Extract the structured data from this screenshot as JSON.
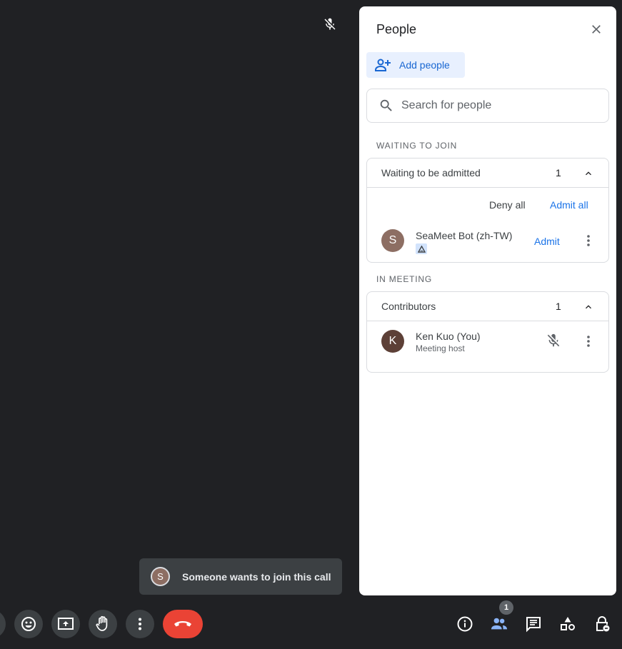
{
  "panel": {
    "title": "People",
    "add_people_label": "Add people",
    "search_placeholder": "Search for people",
    "waiting_section": {
      "label": "WAITING TO JOIN",
      "group_label": "Waiting to be admitted",
      "count": "1",
      "deny_all_label": "Deny all",
      "admit_all_label": "Admit all",
      "people": [
        {
          "initial": "S",
          "name": "SeaMeet Bot (zh-TW)",
          "avatar_color": "#8d6e63",
          "admit_label": "Admit"
        }
      ]
    },
    "meeting_section": {
      "label": "IN MEETING",
      "group_label": "Contributors",
      "count": "1",
      "people": [
        {
          "initial": "K",
          "name": "Ken Kuo (You)",
          "role": "Meeting host",
          "avatar_color": "#5d4037"
        }
      ]
    }
  },
  "toast": {
    "initial": "S",
    "message": "Someone wants to join this call"
  },
  "toolbar": {
    "people_badge_count": "1",
    "accent_color": "#8ab4f8",
    "end_call_color": "#ea4335"
  }
}
